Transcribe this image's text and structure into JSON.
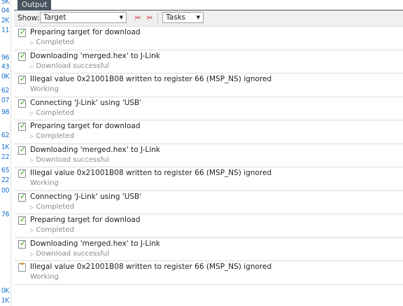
{
  "gutter": {
    "numbers": [
      "5K",
      "04",
      "2K",
      "11",
      "96",
      "43",
      "0K",
      "62",
      "07",
      "98",
      "62",
      "1K",
      "22",
      "65",
      "22",
      "00",
      "76",
      "0K",
      "1K"
    ]
  },
  "panel": {
    "title": "Output"
  },
  "toolbar": {
    "show_label": "Show:",
    "source_select": "Target",
    "tasks_select": "Tasks",
    "icons": [
      "clear-red-icon",
      "clear-all-red-icon"
    ]
  },
  "entries": [
    {
      "message": "Preparing target for download",
      "detail": "Completed",
      "expandable": true,
      "status": "done"
    },
    {
      "message": "Downloading 'merged.hex' to J-Link",
      "detail": "Download successful",
      "expandable": true,
      "status": "done"
    },
    {
      "message": "Illegal value 0x21001B08 written to register 66 (MSP_NS) ignored",
      "detail": "Working",
      "expandable": false,
      "status": "done"
    },
    {
      "message": "Connecting 'J-Link' using 'USB'",
      "detail": "Completed",
      "expandable": true,
      "status": "done"
    },
    {
      "message": "Preparing target for download",
      "detail": "Completed",
      "expandable": true,
      "status": "done"
    },
    {
      "message": "Downloading 'merged.hex' to J-Link",
      "detail": "Download successful",
      "expandable": true,
      "status": "done"
    },
    {
      "message": "Illegal value 0x21001B08 written to register 66 (MSP_NS) ignored",
      "detail": "Working",
      "expandable": false,
      "status": "done"
    },
    {
      "message": "Connecting 'J-Link' using 'USB'",
      "detail": "Completed",
      "expandable": true,
      "status": "done"
    },
    {
      "message": "Preparing target for download",
      "detail": "Completed",
      "expandable": true,
      "status": "done"
    },
    {
      "message": "Downloading 'merged.hex' to J-Link",
      "detail": "Download successful",
      "expandable": true,
      "status": "done"
    },
    {
      "message": "Illegal value 0x21001B08 written to register 66 (MSP_NS) ignored",
      "detail": "Working",
      "expandable": false,
      "status": "pending"
    }
  ]
}
